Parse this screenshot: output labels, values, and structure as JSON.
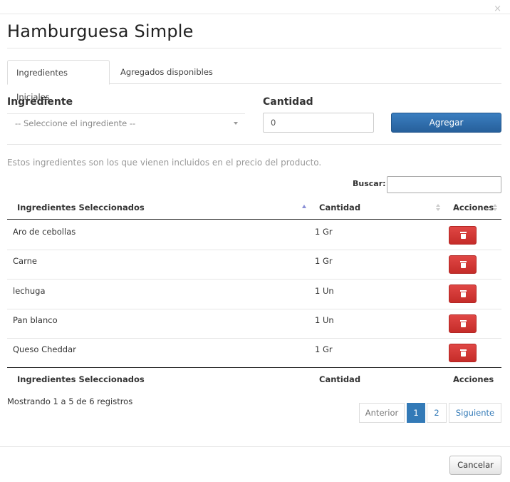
{
  "modal": {
    "close_glyph": "×",
    "title": "Hamburguesa Simple"
  },
  "tabs": [
    {
      "label": "Ingredientes Iniciales",
      "active": true
    },
    {
      "label": "Agregados disponibles",
      "active": false
    }
  ],
  "form": {
    "ingredient_label": "Ingrediente",
    "ingredient_placeholder": "-- Seleccione el ingrediente --",
    "quantity_label": "Cantidad",
    "quantity_value": "0",
    "add_button": "Agregar"
  },
  "hint_text": "Estos ingredientes son los que vienen incluidos en el precio del producto.",
  "search": {
    "label": "Buscar:",
    "value": ""
  },
  "table": {
    "columns": [
      "Ingredientes Seleccionados",
      "Cantidad",
      "Acciones"
    ],
    "rows": [
      {
        "ingredient": "Aro de cebollas",
        "quantity": "1 Gr"
      },
      {
        "ingredient": "Carne",
        "quantity": "1 Gr"
      },
      {
        "ingredient": "lechuga",
        "quantity": "1 Un"
      },
      {
        "ingredient": "Pan blanco",
        "quantity": "1 Un"
      },
      {
        "ingredient": "Queso Cheddar",
        "quantity": "1 Gr"
      }
    ]
  },
  "pagination": {
    "info": "Mostrando 1 a 5 de 6 registros",
    "prev": "Anterior",
    "pages": [
      "1",
      "2"
    ],
    "current": "1",
    "next": "Siguiente"
  },
  "footer": {
    "cancel_button": "Cancelar"
  },
  "colors": {
    "primary": "#2a6aa8",
    "danger": "#d43f3a",
    "page_active": "#337ab7"
  },
  "icons": {
    "delete": "trash-icon",
    "sort": "sort-icon",
    "close": "close-icon"
  }
}
